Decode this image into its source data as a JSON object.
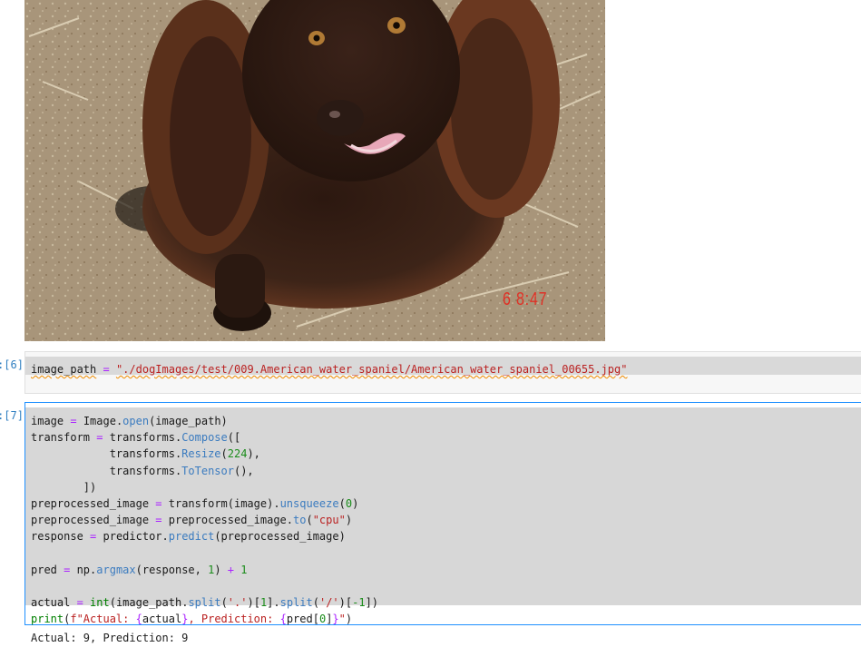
{
  "image_output": {
    "timestamp": "6   8:47",
    "colors": {
      "ground": "#a8957a",
      "fur": "#3d2418",
      "fur_highlight": "#6b3a22",
      "timestamp": "#e03025"
    }
  },
  "cells": [
    {
      "prompt": "[6]:",
      "code_lines": [
        [
          {
            "t": "image_path",
            "c": "pn"
          },
          {
            "t": " ",
            "c": "pn"
          },
          {
            "t": "=",
            "c": "op"
          },
          {
            "t": " ",
            "c": "pn"
          },
          {
            "t": "\"./dogImages/test/009.American_water_spaniel/American_water_spaniel_00655.jpg\"",
            "c": "str"
          }
        ]
      ]
    },
    {
      "prompt": "[7]:",
      "code_lines": [
        [
          {
            "t": "image",
            "c": "pn"
          },
          {
            "t": " ",
            "c": "pn"
          },
          {
            "t": "=",
            "c": "op"
          },
          {
            "t": " Image.",
            "c": "pn"
          },
          {
            "t": "open",
            "c": "fn"
          },
          {
            "t": "(image_path)",
            "c": "pn"
          }
        ],
        [
          {
            "t": "transform ",
            "c": "pn"
          },
          {
            "t": "=",
            "c": "op"
          },
          {
            "t": " transforms.",
            "c": "pn"
          },
          {
            "t": "Compose",
            "c": "fn"
          },
          {
            "t": "([",
            "c": "pn"
          }
        ],
        [
          {
            "t": "            transforms.",
            "c": "pn"
          },
          {
            "t": "Resize",
            "c": "fn"
          },
          {
            "t": "(",
            "c": "pn"
          },
          {
            "t": "224",
            "c": "num"
          },
          {
            "t": "),",
            "c": "pn"
          }
        ],
        [
          {
            "t": "            transforms.",
            "c": "pn"
          },
          {
            "t": "ToTensor",
            "c": "fn"
          },
          {
            "t": "(),",
            "c": "pn"
          }
        ],
        [
          {
            "t": "        ])",
            "c": "pn"
          }
        ],
        [
          {
            "t": "preprocessed_image ",
            "c": "pn"
          },
          {
            "t": "=",
            "c": "op"
          },
          {
            "t": " transform(image).",
            "c": "pn"
          },
          {
            "t": "unsqueeze",
            "c": "fn"
          },
          {
            "t": "(",
            "c": "pn"
          },
          {
            "t": "0",
            "c": "num"
          },
          {
            "t": ")",
            "c": "pn"
          }
        ],
        [
          {
            "t": "preprocessed_image ",
            "c": "pn"
          },
          {
            "t": "=",
            "c": "op"
          },
          {
            "t": " preprocessed_image.",
            "c": "pn"
          },
          {
            "t": "to",
            "c": "fn"
          },
          {
            "t": "(",
            "c": "pn"
          },
          {
            "t": "\"cpu\"",
            "c": "str"
          },
          {
            "t": ")",
            "c": "pn"
          }
        ],
        [
          {
            "t": "response ",
            "c": "pn"
          },
          {
            "t": "=",
            "c": "op"
          },
          {
            "t": " predictor.",
            "c": "pn"
          },
          {
            "t": "predict",
            "c": "fn"
          },
          {
            "t": "(preprocessed_image)",
            "c": "pn"
          }
        ],
        [],
        [
          {
            "t": "pred ",
            "c": "pn"
          },
          {
            "t": "=",
            "c": "op"
          },
          {
            "t": " np.",
            "c": "pn"
          },
          {
            "t": "argmax",
            "c": "fn"
          },
          {
            "t": "(response, ",
            "c": "pn"
          },
          {
            "t": "1",
            "c": "num"
          },
          {
            "t": ") ",
            "c": "pn"
          },
          {
            "t": "+",
            "c": "op"
          },
          {
            "t": " ",
            "c": "pn"
          },
          {
            "t": "1",
            "c": "num"
          }
        ],
        [],
        [
          {
            "t": "actual ",
            "c": "pn"
          },
          {
            "t": "=",
            "c": "op"
          },
          {
            "t": " ",
            "c": "pn"
          },
          {
            "t": "int",
            "c": "bi"
          },
          {
            "t": "(image_path.",
            "c": "pn"
          },
          {
            "t": "split",
            "c": "fn"
          },
          {
            "t": "(",
            "c": "pn"
          },
          {
            "t": "'.'",
            "c": "str"
          },
          {
            "t": ")[",
            "c": "pn"
          },
          {
            "t": "1",
            "c": "num"
          },
          {
            "t": "].",
            "c": "pn"
          },
          {
            "t": "split",
            "c": "fn"
          },
          {
            "t": "(",
            "c": "pn"
          },
          {
            "t": "'/'",
            "c": "str"
          },
          {
            "t": ")[",
            "c": "pn"
          },
          {
            "t": "-1",
            "c": "num"
          },
          {
            "t": "])",
            "c": "pn"
          }
        ],
        [
          {
            "t": "print",
            "c": "bi"
          },
          {
            "t": "(",
            "c": "pn"
          },
          {
            "t": "f\"Actual: ",
            "c": "str"
          },
          {
            "t": "{",
            "c": "op"
          },
          {
            "t": "actual",
            "c": "pn"
          },
          {
            "t": "}",
            "c": "op"
          },
          {
            "t": ", Prediction: ",
            "c": "str"
          },
          {
            "t": "{",
            "c": "op"
          },
          {
            "t": "pred[",
            "c": "pn"
          },
          {
            "t": "0",
            "c": "num"
          },
          {
            "t": "]",
            "c": "pn"
          },
          {
            "t": "}",
            "c": "op"
          },
          {
            "t": "\"",
            "c": "str"
          },
          {
            "t": ")",
            "c": "pn"
          }
        ]
      ]
    }
  ],
  "output": "Actual: 9, Prediction: 9"
}
